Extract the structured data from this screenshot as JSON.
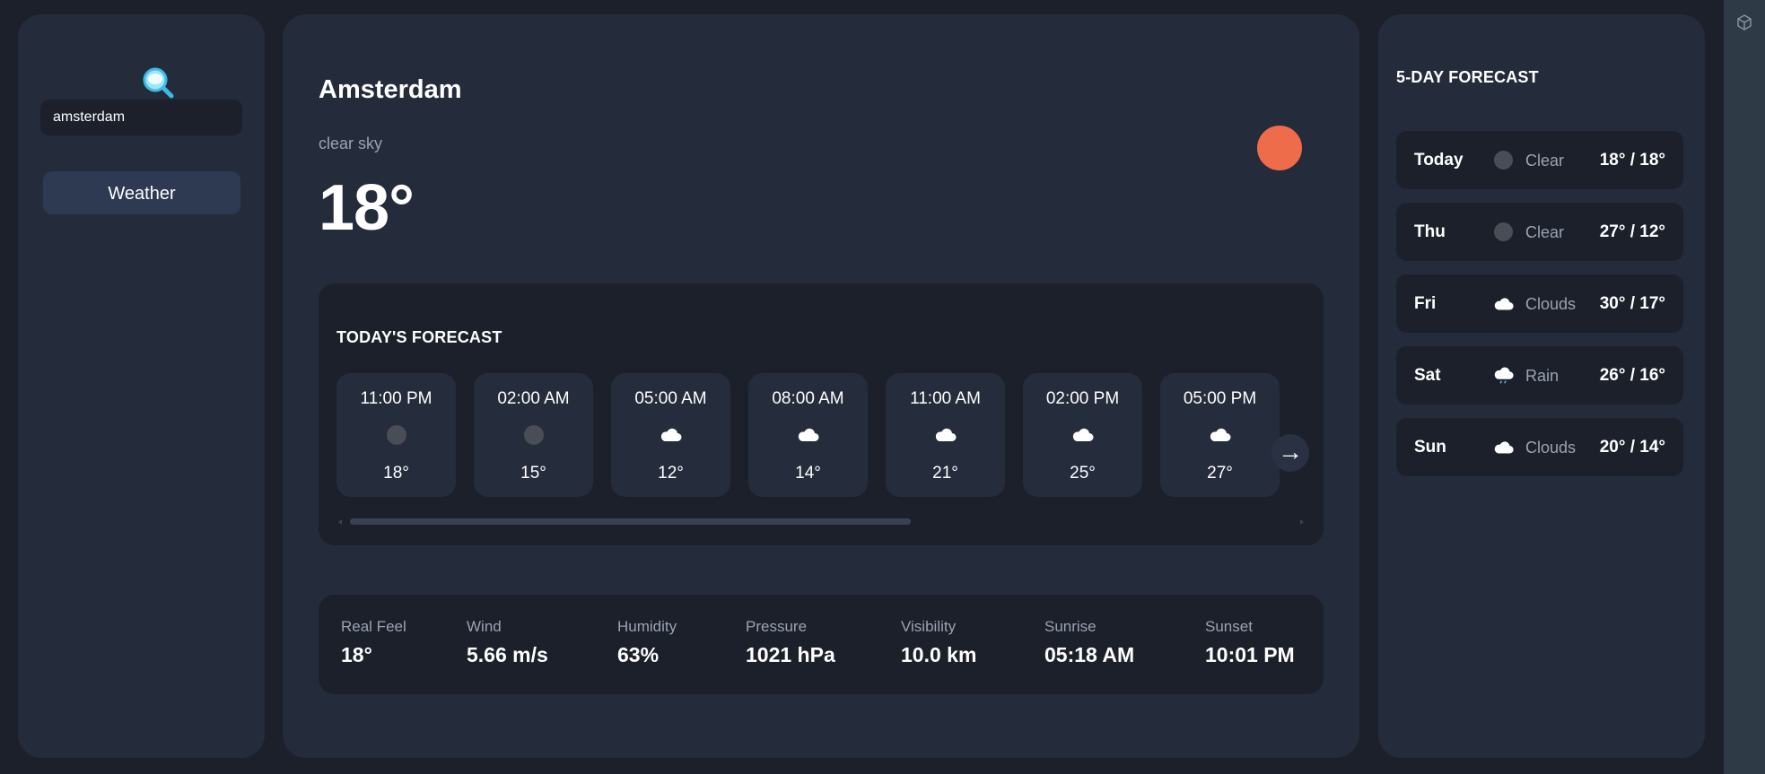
{
  "sidebar": {
    "search_value": "amsterdam",
    "nav_button_label": "Weather",
    "search_icon": "magnifier-icon"
  },
  "current": {
    "city": "Amsterdam",
    "condition": "clear sky",
    "temperature": "18°",
    "icon": "sun-dot-icon",
    "icon_color": "#ef6c4a"
  },
  "today_forecast": {
    "title": "TODAY'S FORECAST",
    "hours": [
      {
        "time": "11:00 PM",
        "icon": "clear-dot-icon",
        "temp": "18°"
      },
      {
        "time": "02:00 AM",
        "icon": "clear-dot-icon",
        "temp": "15°"
      },
      {
        "time": "05:00 AM",
        "icon": "cloud-icon",
        "temp": "12°"
      },
      {
        "time": "08:00 AM",
        "icon": "cloud-icon",
        "temp": "14°"
      },
      {
        "time": "11:00 AM",
        "icon": "cloud-icon",
        "temp": "21°"
      },
      {
        "time": "02:00 PM",
        "icon": "cloud-icon",
        "temp": "25°"
      },
      {
        "time": "05:00 PM",
        "icon": "cloud-icon",
        "temp": "27°"
      }
    ],
    "next_arrow": "→"
  },
  "details": {
    "items": [
      {
        "label": "Real Feel",
        "value": "18°"
      },
      {
        "label": "Wind",
        "value": "5.66 m/s"
      },
      {
        "label": "Humidity",
        "value": "63%"
      },
      {
        "label": "Pressure",
        "value": "1021 hPa"
      },
      {
        "label": "Visibility",
        "value": "10.0 km"
      },
      {
        "label": "Sunrise",
        "value": "05:18 AM"
      },
      {
        "label": "Sunset",
        "value": "10:01 PM"
      }
    ]
  },
  "five_day": {
    "title": "5-DAY FORECAST",
    "days": [
      {
        "day": "Today",
        "icon": "clear-dot-icon",
        "condition": "Clear",
        "range": "18° / 18°"
      },
      {
        "day": "Thu",
        "icon": "clear-dot-icon",
        "condition": "Clear",
        "range": "27° / 12°"
      },
      {
        "day": "Fri",
        "icon": "cloud-icon",
        "condition": "Clouds",
        "range": "30° / 17°"
      },
      {
        "day": "Sat",
        "icon": "rain-cloud-icon",
        "condition": "Rain",
        "range": "26° / 16°"
      },
      {
        "day": "Sun",
        "icon": "cloud-icon",
        "condition": "Clouds",
        "range": "20° / 14°"
      }
    ]
  },
  "colors": {
    "background": "#1b202b",
    "panel": "#242b3b",
    "accent_sun": "#ef6c4a",
    "muted_text": "#9ba3b2"
  }
}
